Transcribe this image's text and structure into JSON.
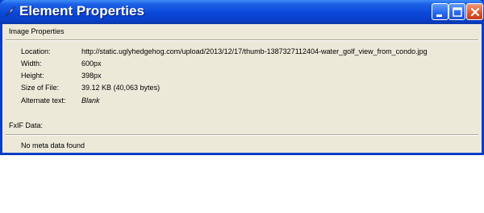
{
  "window": {
    "title": "Element Properties"
  },
  "image_properties": {
    "heading": "Image Properties",
    "rows": [
      {
        "label": "Location:",
        "value": "http://static.uglyhedgehog.com/upload/2013/12/17/thumb-1387327112404-water_golf_view_from_condo.jpg"
      },
      {
        "label": "Width:",
        "value": "600px"
      },
      {
        "label": "Height:",
        "value": "398px"
      },
      {
        "label": "Size of File:",
        "value": "39.12 KB (40,063 bytes)"
      },
      {
        "label": "Alternate text:",
        "value": "Blank"
      }
    ]
  },
  "exif": {
    "heading": "FxIF Data:",
    "message": "No meta data found"
  },
  "icons": {
    "app": "feather-icon",
    "minimize": "minimize-icon",
    "maximize": "maximize-icon",
    "close": "close-icon"
  },
  "colors": {
    "titlebar": "#0a47d9",
    "client_background": "#ece9d8",
    "close_button": "#e05a2e"
  }
}
